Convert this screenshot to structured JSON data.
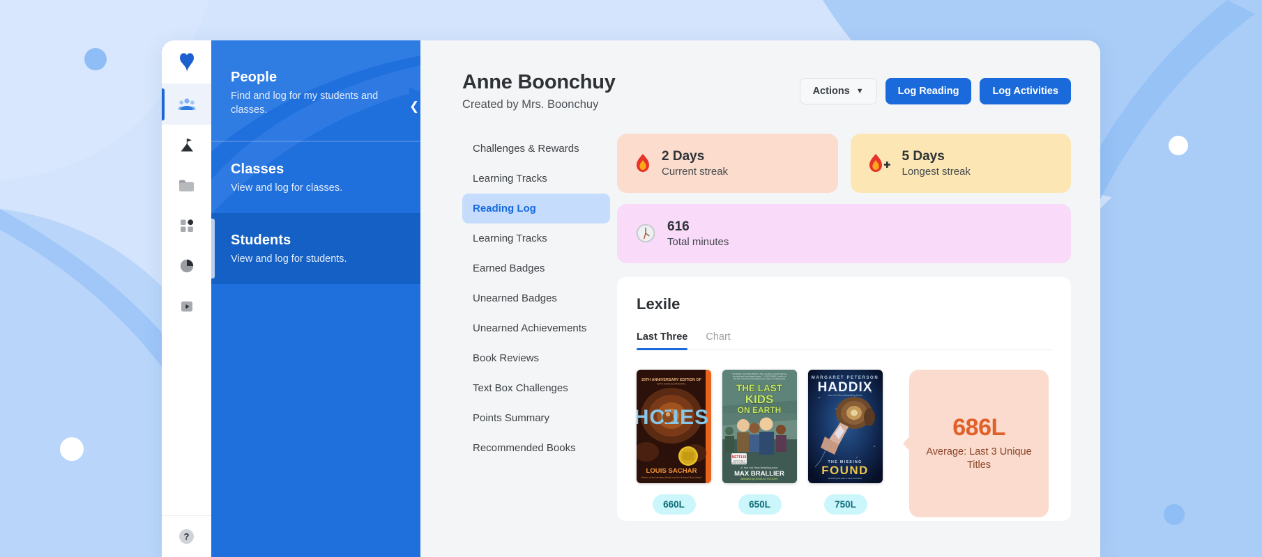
{
  "brand": {
    "accent": "#1b6adb",
    "panel_blue": "#1f6fdd",
    "panel_blue_dark": "#1560c4"
  },
  "rail": {
    "logo_icon": "heart-logo-icon",
    "items": [
      {
        "icon": "people-group-icon",
        "name": "people",
        "active": true
      },
      {
        "icon": "mountain-flag-icon",
        "name": "goals",
        "active": false
      },
      {
        "icon": "folder-icon",
        "name": "library",
        "active": false
      },
      {
        "icon": "grid-squares-icon",
        "name": "apps",
        "active": false
      },
      {
        "icon": "pie-chart-icon",
        "name": "reports",
        "active": false
      },
      {
        "icon": "play-button-icon",
        "name": "videos",
        "active": false
      }
    ],
    "help_label": "?"
  },
  "navpanel": {
    "collapse_icon": "chevron-left-icon",
    "sections": [
      {
        "title": "People",
        "desc": "Find and log for my students and classes.",
        "selected": false
      },
      {
        "title": "Classes",
        "desc": "View and log for classes.",
        "selected": false
      },
      {
        "title": "Students",
        "desc": "View and log for students.",
        "selected": true
      }
    ]
  },
  "header": {
    "title": "Anne Boonchuy",
    "subtitle": "Created by Mrs. Boonchuy",
    "actions_label": "Actions",
    "actions_caret_icon": "chevron-down-icon",
    "log_reading_label": "Log Reading",
    "log_activities_label": "Log Activities"
  },
  "section_menu": {
    "items": [
      {
        "label": "Challenges & Rewards",
        "active": false
      },
      {
        "label": "Learning Tracks",
        "active": false
      },
      {
        "label": "Reading Log",
        "active": true
      },
      {
        "label": "Learning Tracks",
        "active": false
      },
      {
        "label": "Earned Badges",
        "active": false
      },
      {
        "label": "Unearned Badges",
        "active": false
      },
      {
        "label": "Unearned Achievements",
        "active": false
      },
      {
        "label": "Book Reviews",
        "active": false
      },
      {
        "label": "Text Box Challenges",
        "active": false
      },
      {
        "label": "Points Summary",
        "active": false
      },
      {
        "label": "Recommended Books",
        "active": false
      }
    ]
  },
  "stats": [
    {
      "icon": "flame-icon",
      "value": "2 Days",
      "label": "Current streak",
      "bg": "#fbdccd"
    },
    {
      "icon": "flame-plus-icon",
      "value": "5 Days",
      "label": "Longest streak",
      "bg": "#fce7b4"
    },
    {
      "icon": "clock-icon",
      "value": "616",
      "label": "Total minutes",
      "bg": "#f9daf9"
    }
  ],
  "lexile": {
    "title": "Lexile",
    "tabs": [
      {
        "label": "Last Three",
        "active": true
      },
      {
        "label": "Chart",
        "active": false
      }
    ],
    "books": [
      {
        "cover_name": "holes-book-cover",
        "title_line1": "20TH ANNIVERSARY EDITION OF",
        "title_word": "HOLES",
        "subline": "WITH BONUS MATERIAL",
        "big_title": "H●LES",
        "author": "LOUIS SACHAR",
        "award": "Winner of the Newbery Medal and the National Book Award",
        "lexile": "660L"
      },
      {
        "cover_name": "last-kids-on-earth-book-cover",
        "line1": "THE LAST",
        "line2": "KIDS",
        "line3": "ON EARTH",
        "author": "MAX BRALLIER",
        "illustrator": "DOUGLAS HOLGATE",
        "badge": "NETFLIX",
        "lexile": "650L"
      },
      {
        "cover_name": "found-haddix-book-cover",
        "author_top": "MARGARET PETERSON",
        "author_big": "HADDIX",
        "series": "THE MISSING",
        "book_title": "FOUND",
        "tagline": "Rewriting the past to save the future",
        "lexile": "750L"
      }
    ],
    "average": {
      "value": "686L",
      "label": "Average: Last 3 Unique Titles"
    }
  }
}
